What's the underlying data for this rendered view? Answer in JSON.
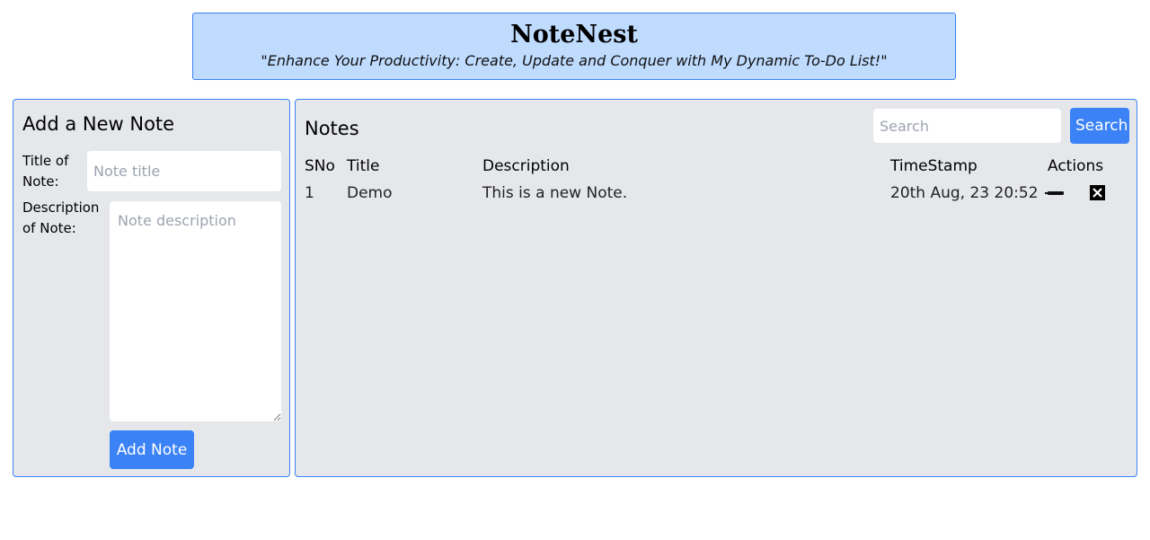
{
  "header": {
    "title": "NoteNest",
    "tagline": "\"Enhance Your Productivity: Create, Update and Conquer with My Dynamic To-Do List!\""
  },
  "add_note": {
    "heading": "Add a New Note",
    "title_label": "Title of Note:",
    "title_placeholder": "Note title",
    "title_value": "",
    "description_label": "Description of Note:",
    "description_placeholder": "Note description",
    "description_value": "",
    "submit_label": "Add Note"
  },
  "notes": {
    "heading": "Notes",
    "search_placeholder": "Search",
    "search_value": "",
    "search_button_label": "Search",
    "columns": [
      "SNo",
      "Title",
      "Description",
      "TimeStamp",
      "Actions"
    ],
    "rows": [
      {
        "sno": "1",
        "title": "Demo",
        "description": "This is a new Note.",
        "timestamp": "20th Aug, 23 20:52",
        "actions": [
          "edit-icon",
          "delete-icon"
        ]
      }
    ]
  },
  "colors": {
    "accent": "#3b82f6",
    "header_bg": "#bfdbfe",
    "panel_bg": "#e5e7eb"
  }
}
